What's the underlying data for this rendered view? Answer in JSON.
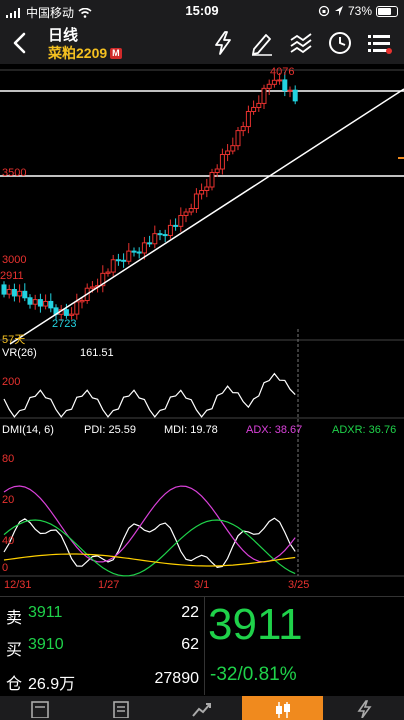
{
  "status_bar": {
    "carrier": "中国移动",
    "time": "15:09",
    "battery": "73%",
    "battery_level": 0.73
  },
  "nav": {
    "title": "日线",
    "contract": "菜粕2209",
    "badge": "M"
  },
  "kline": {
    "high_label": "4076",
    "low_label": "2723",
    "left_start_label": "2911",
    "y_labels": [
      "3500",
      "3000"
    ],
    "period_label": "57天"
  },
  "vr": {
    "name": "VR(26)",
    "value": "161.51",
    "axis_label": "200"
  },
  "dmi": {
    "name": "DMI(14, 6)",
    "pdi": "PDI: 25.59",
    "mdi": "MDI: 19.78",
    "adx": "ADX: 38.67",
    "adxr": "ADXR: 36.76",
    "axis_labels": [
      "80",
      "20",
      "40",
      "0"
    ]
  },
  "dates": [
    "12/31",
    "1/27",
    "3/1",
    "3/25"
  ],
  "quote": {
    "sell_label": "卖",
    "sell_price": "3911",
    "sell_vol": "22",
    "buy_label": "买",
    "buy_price": "3910",
    "buy_vol": "62",
    "oi_label": "仓",
    "oi_value": "26.9万",
    "oi_vol": "27890",
    "last_price": "3911",
    "change": "-32/0.81%"
  },
  "colors": {
    "up": "#e8322f",
    "down": "#23d3e0",
    "pdi": "#ffffff",
    "mdi": "#d941d9",
    "adx": "#ffd000",
    "adxr": "#1fd24a",
    "accent": "#f08a1e"
  },
  "tabs": [
    "news-tab",
    "report-tab",
    "trend-tab",
    "kline-tab",
    "trade-tab"
  ]
}
